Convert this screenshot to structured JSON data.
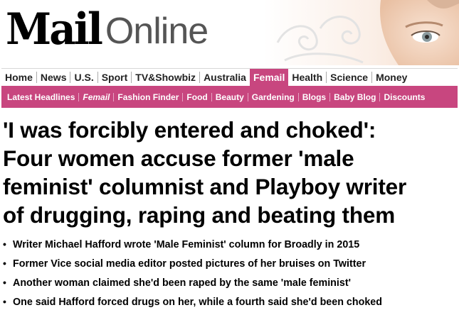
{
  "brand": {
    "mail": "Mail",
    "online": "Online"
  },
  "colors": {
    "accent": "#c8467f",
    "logo_gray": "#555555"
  },
  "nav_primary": [
    {
      "label": "Home",
      "active": false
    },
    {
      "label": "News",
      "active": false
    },
    {
      "label": "U.S.",
      "active": false
    },
    {
      "label": "Sport",
      "active": false
    },
    {
      "label": "TV&Showbiz",
      "active": false
    },
    {
      "label": "Australia",
      "active": false
    },
    {
      "label": "Femail",
      "active": true
    },
    {
      "label": "Health",
      "active": false
    },
    {
      "label": "Science",
      "active": false
    },
    {
      "label": "Money",
      "active": false
    }
  ],
  "nav_secondary": [
    {
      "label": "Latest Headlines",
      "italic": false
    },
    {
      "label": "Femail",
      "italic": true
    },
    {
      "label": "Fashion Finder",
      "italic": false
    },
    {
      "label": "Food",
      "italic": false
    },
    {
      "label": "Beauty",
      "italic": false
    },
    {
      "label": "Gardening",
      "italic": false
    },
    {
      "label": "Blogs",
      "italic": false
    },
    {
      "label": "Baby Blog",
      "italic": false
    },
    {
      "label": "Discounts",
      "italic": false
    }
  ],
  "article": {
    "headline_lines": [
      "'I was forcibly entered and choked':",
      "Four women accuse former 'male",
      "feminist' columnist and Playboy writer",
      "of drugging, raping and beating them"
    ],
    "bullets": [
      "Writer Michael Hafford wrote 'Male Feminist' column for Broadly in 2015",
      "Former Vice social media editor posted pictures of her bruises on Twitter",
      "Another woman claimed she'd been raped by the same 'male feminist'",
      "One said Hafford forced drugs on her, while a fourth said she'd been choked"
    ]
  }
}
